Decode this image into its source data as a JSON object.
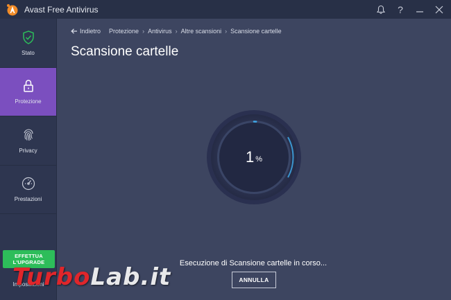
{
  "window": {
    "title": "Avast Free Antivirus"
  },
  "sidebar": {
    "items": [
      {
        "label": "Stato",
        "icon": "shield-check-icon"
      },
      {
        "label": "Protezione",
        "icon": "lock-icon",
        "active": true
      },
      {
        "label": "Privacy",
        "icon": "fingerprint-icon"
      },
      {
        "label": "Prestazioni",
        "icon": "speedometer-icon"
      }
    ],
    "upgrade": {
      "line1": "EFFETTUA",
      "line2": "L'UPGRADE"
    },
    "settings_label": "Impostazioni"
  },
  "breadcrumb": {
    "back_label": "Indietro",
    "items": [
      "Protezione",
      "Antivirus",
      "Altre scansioni",
      "Scansione cartelle"
    ]
  },
  "main": {
    "title": "Scansione cartelle",
    "progress": {
      "value": 1,
      "unit": "%"
    },
    "status_text": "Esecuzione di Scansione cartelle in corso...",
    "cancel_label": "ANNULLA"
  },
  "watermark": {
    "part1": "Turbo",
    "part2": "Lab",
    "part3": ".it"
  },
  "colors": {
    "accent": "#7b4fbf",
    "upgrade": "#2dbd5a",
    "progress": "#3ea8e8",
    "logo": "#f28c28"
  }
}
